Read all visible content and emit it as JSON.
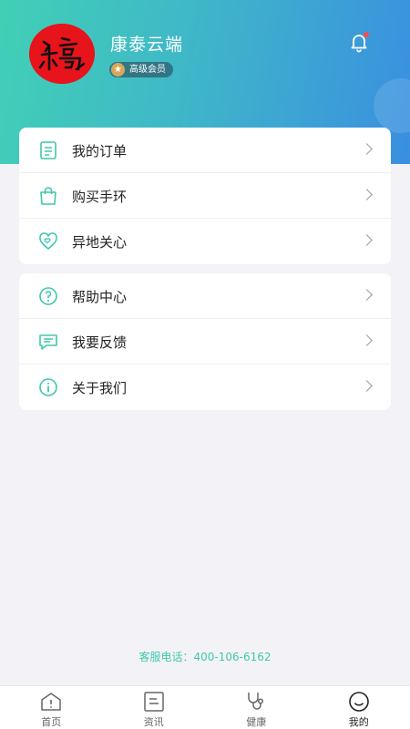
{
  "profile": {
    "name": "康泰云端",
    "member_level": "高级会员"
  },
  "menu_group_1": [
    {
      "label": "我的订单",
      "icon": "order-icon"
    },
    {
      "label": "购买手环",
      "icon": "shopping-bag-icon"
    },
    {
      "label": "异地关心",
      "icon": "heart-care-icon"
    }
  ],
  "menu_group_2": [
    {
      "label": "帮助中心",
      "icon": "help-icon"
    },
    {
      "label": "我要反馈",
      "icon": "feedback-icon"
    },
    {
      "label": "关于我们",
      "icon": "info-icon"
    }
  ],
  "footer": {
    "service_phone": "客服电话：400-106-6162"
  },
  "tabbar": [
    {
      "label": "首页",
      "icon": "home-icon"
    },
    {
      "label": "资讯",
      "icon": "news-icon"
    },
    {
      "label": "健康",
      "icon": "stethoscope-icon"
    },
    {
      "label": "我的",
      "icon": "profile-icon",
      "active": true
    }
  ],
  "colors": {
    "accent": "#41c7ad",
    "header_start": "#41d0b6",
    "header_end": "#3a8fe0",
    "badge_gold": "#d8a85a",
    "notification_dot": "#ff4d4d"
  }
}
